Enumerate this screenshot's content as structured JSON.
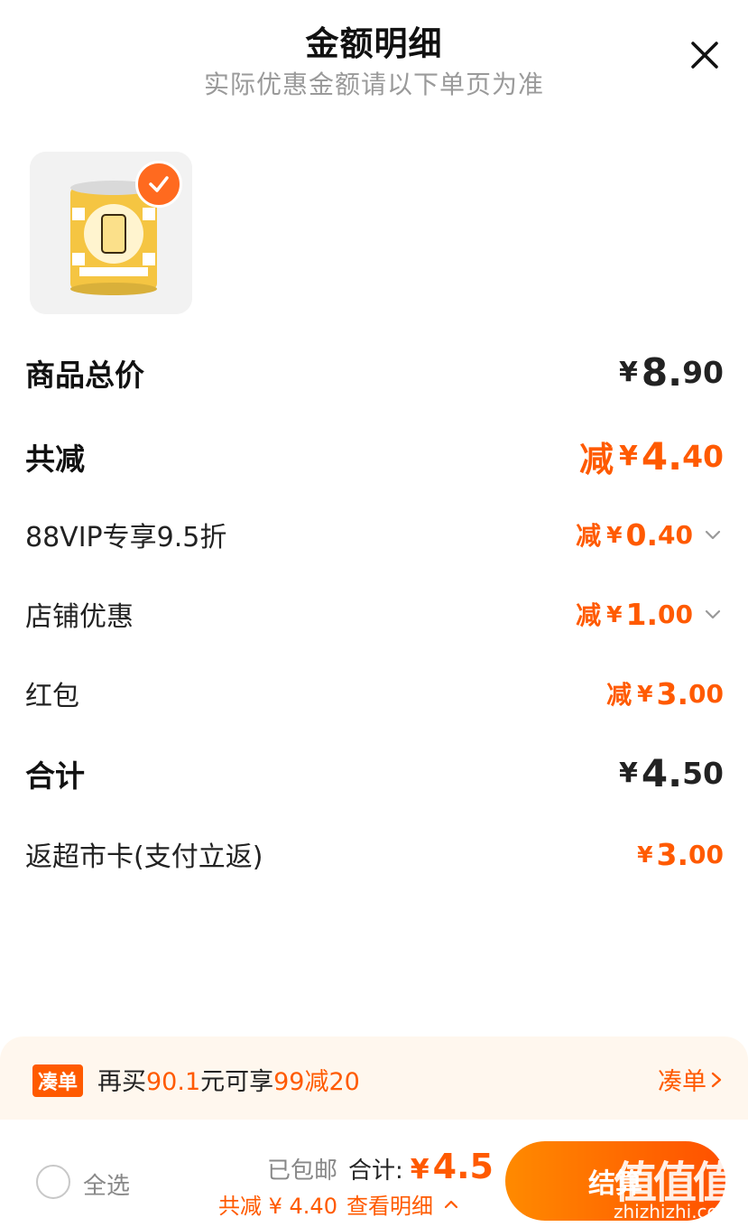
{
  "header": {
    "title": "金额明细",
    "subtitle": "实际优惠金额请以下单页为准"
  },
  "rows": {
    "goods_total": {
      "label": "商品总价",
      "yen": "¥",
      "int": "8.",
      "dec": "90"
    },
    "total_discount": {
      "label": "共减",
      "prefix": "减",
      "yen": "¥",
      "int": "4.",
      "dec": "40"
    },
    "vip": {
      "label": "88VIP专享9.5折",
      "prefix": "减",
      "yen": "¥",
      "int": "0.",
      "dec": "40"
    },
    "shop": {
      "label": "店铺优惠",
      "prefix": "减",
      "yen": "¥",
      "int": "1.",
      "dec": "00"
    },
    "redpack": {
      "label": "红包",
      "prefix": "减",
      "yen": "¥",
      "int": "3.",
      "dec": "00"
    },
    "subtotal": {
      "label": "合计",
      "yen": "¥",
      "int": "4.",
      "dec": "50"
    },
    "cashback": {
      "label": "返超市卡(支付立返)",
      "yen": "¥",
      "int": "3.",
      "dec": "00"
    }
  },
  "bundle": {
    "tag": "凑单",
    "msg_a": "再买",
    "msg_b": "90.1",
    "msg_c": "元可享",
    "msg_d": "99减20",
    "link": "凑单"
  },
  "footer": {
    "select_all": "全选",
    "free_shipping": "已包邮",
    "sum_label": "合计:",
    "yen": "¥",
    "total": "4.5",
    "discount_text": "共减 ¥ 4.40",
    "detail_link": "查看明细",
    "checkout": "结算",
    "watermark": "值值值",
    "watermark_url": "zhizhizhi.com"
  },
  "colors": {
    "accent": "#ff5a00",
    "muted": "#9a9a9a",
    "bundle_bg": "#fff7ee"
  }
}
